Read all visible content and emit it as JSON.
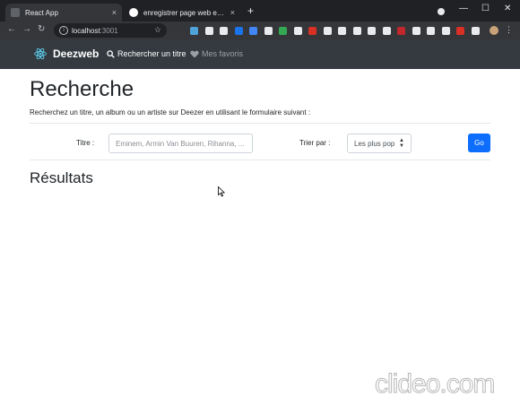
{
  "browser": {
    "tabs": [
      {
        "title": "React App",
        "favicon_color": "#5f6368",
        "close": "×"
      },
      {
        "title": "enregistrer page web en video",
        "favicon_color": "#ffffff",
        "close": "×"
      }
    ],
    "new_tab": "+",
    "window_controls": {
      "minimize": "—",
      "maximize": "☐",
      "close": "✕"
    },
    "nav": {
      "back": "←",
      "forward": "→",
      "reload": "↻"
    },
    "address": {
      "host": "localhost",
      "port": ":3001",
      "info": "i",
      "star": "☆"
    },
    "extension_colors": [
      "#4fa3d9",
      "#e8eaed",
      "#e8eaed",
      "#1a73e8",
      "#4285f4",
      "#e8eaed",
      "#34a853",
      "#e8eaed",
      "#d93025",
      "#e8eaed",
      "#e8eaed",
      "#e8eaed",
      "#e8eaed",
      "#e8eaed",
      "#c1272d",
      "#e8eaed",
      "#e8eaed",
      "#e8eaed",
      "#d93025",
      "#e8eaed"
    ],
    "kebab": "⋮"
  },
  "app": {
    "brand": "Deezweb",
    "nav": {
      "search_label": "Rechercher un titre",
      "favorites_label": "Mes favoris",
      "search_icon": "search-icon",
      "favorites_icon": "heart-icon"
    },
    "page": {
      "title": "Recherche",
      "lead": "Recherchez un titre, un album ou un artiste sur Deezer en utilisant le formulaire suivant :",
      "form": {
        "title_label": "Titre :",
        "title_value": "",
        "title_placeholder": "Eminem, Armin Van Buuren, Rihanna, ...",
        "sort_label": "Trier par :",
        "sort_value": "Les plus pop",
        "submit_label": "Go"
      },
      "results_title": "Résultats"
    },
    "colors": {
      "navbar": "#343a40",
      "primary": "#0d6efd",
      "react_logo": "#61dafb"
    }
  },
  "watermark": "clideo.com"
}
